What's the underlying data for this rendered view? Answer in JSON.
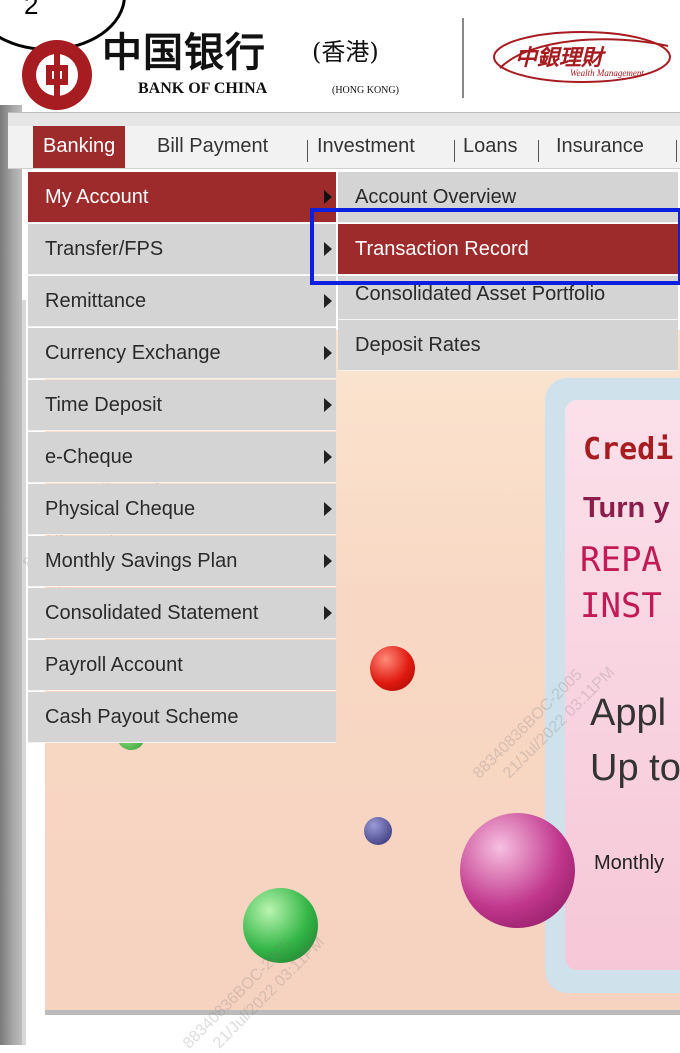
{
  "step": {
    "number": "2"
  },
  "brand": {
    "name_cn": "中国银行",
    "name_cn_suffix": "(香港)",
    "name_en": "BANK OF CHINA",
    "name_en_suffix": "(HONG KONG)",
    "wealth_cn": "中銀理財",
    "wealth_en": "Wealth Management"
  },
  "nav": {
    "tabs": [
      {
        "label": "Banking",
        "active": true
      },
      {
        "label": "Bill Payment"
      },
      {
        "label": "Investment"
      },
      {
        "label": "Loans"
      },
      {
        "label": "Insurance"
      }
    ]
  },
  "banking_menu": {
    "items": [
      {
        "label": "My Account",
        "has_submenu": true,
        "active": true
      },
      {
        "label": "Transfer/FPS",
        "has_submenu": true
      },
      {
        "label": "Remittance",
        "has_submenu": true
      },
      {
        "label": "Currency Exchange",
        "has_submenu": true
      },
      {
        "label": "Time Deposit",
        "has_submenu": true
      },
      {
        "label": "e-Cheque",
        "has_submenu": true
      },
      {
        "label": "Physical Cheque",
        "has_submenu": true
      },
      {
        "label": "Monthly Savings Plan",
        "has_submenu": true
      },
      {
        "label": "Consolidated Statement",
        "has_submenu": true
      },
      {
        "label": "Payroll Account",
        "has_submenu": false
      },
      {
        "label": "Cash Payout Scheme",
        "has_submenu": false
      }
    ]
  },
  "my_account_menu": {
    "items": [
      {
        "label": "Account Overview"
      },
      {
        "label": "Transaction Record",
        "active": true
      },
      {
        "label": "Consolidated Asset Portfolio"
      },
      {
        "label": "Deposit Rates"
      }
    ]
  },
  "banner": {
    "line1": "Credi",
    "line2": "Turn y",
    "line3": "REPA",
    "line4": "INST",
    "line5": "Appl",
    "line6": "Up to",
    "line7": "Monthly"
  },
  "watermark": {
    "line1": "88340836BOC-2005",
    "line2": "21/Jul/2022 03:11PM"
  },
  "colors": {
    "brand_red": "#9e2b2b",
    "highlight_blue": "#0a1fe0",
    "menu_gray": "#d4d4d4"
  }
}
